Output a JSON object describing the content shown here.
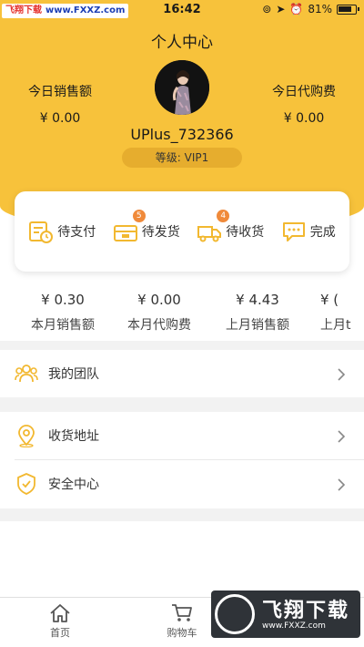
{
  "status_bar": {
    "watermark_left_name": "飞翔下载",
    "watermark_left_url": "www.FXXZ.com",
    "time": "16:42",
    "battery": "81%"
  },
  "header": {
    "title": "个人中心",
    "today_sales_label": "今日销售额",
    "today_sales_value": "¥ 0.00",
    "today_purchase_label": "今日代购费",
    "today_purchase_value": "¥ 0.00",
    "username": "UPlus_732366",
    "level": "等级: VIP1"
  },
  "orders": [
    {
      "label": "待支付",
      "icon": "pending-payment-icon",
      "badge": ""
    },
    {
      "label": "待发货",
      "icon": "pending-shipment-icon",
      "badge": "5"
    },
    {
      "label": "待收货",
      "icon": "truck-icon",
      "badge": "4"
    },
    {
      "label": "完成",
      "icon": "chat-bubble-icon",
      "badge": ""
    }
  ],
  "stats": [
    {
      "value": "¥ 0.30",
      "label": "本月销售额"
    },
    {
      "value": "¥ 0.00",
      "label": "本月代购费"
    },
    {
      "value": "¥ 4.43",
      "label": "上月销售额"
    },
    {
      "value": "¥ (",
      "label": "上月t"
    }
  ],
  "menu": [
    {
      "label": "我的团队",
      "icon": "team-icon"
    },
    {
      "label": "收货地址",
      "icon": "location-icon"
    },
    {
      "label": "安全中心",
      "icon": "shield-icon"
    }
  ],
  "nav": [
    {
      "label": "首页",
      "icon": "home-icon"
    },
    {
      "label": "购物车",
      "icon": "cart-icon"
    }
  ],
  "watermark_bottom": {
    "title": "飞翔下载",
    "url": "www.FXXZ.com"
  },
  "colors": {
    "brand_yellow": "#f7c23b",
    "badge_orange": "#f08a3a",
    "icon_yellow": "#f2b830"
  }
}
